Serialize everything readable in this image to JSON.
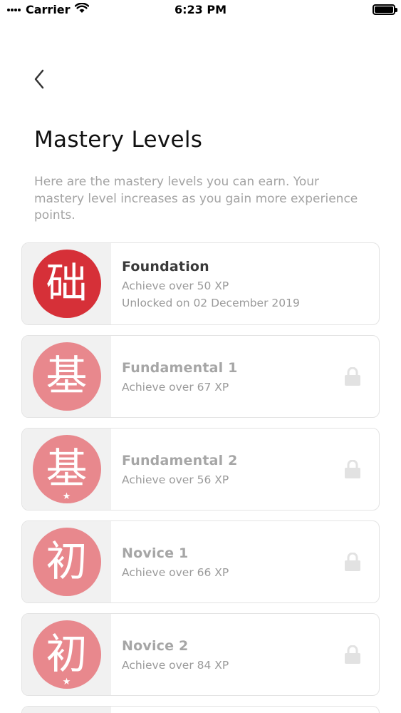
{
  "status_bar": {
    "carrier": "Carrier",
    "time": "6:23 PM",
    "icons": [
      "wifi-icon",
      "battery-icon"
    ]
  },
  "nav": {
    "back_icon": "chevron-left-icon"
  },
  "title": "Mastery Levels",
  "description": "Here are the mastery levels you can earn. Your mastery level increases as you gain more experience points.",
  "colors": {
    "unlocked_badge": "#d63038",
    "locked_badge": "#e8888d",
    "unlocked_title": "#3a3a3a",
    "locked_title": "#a6a6a6",
    "lock_icon": "#e2e2e2"
  },
  "levels": [
    {
      "name": "Foundation",
      "requirement": "Achieve over 50 XP",
      "unlocked": "Unlocked on 02 December 2019",
      "glyph": "础",
      "star": false,
      "locked": false
    },
    {
      "name": "Fundamental 1",
      "requirement": "Achieve over 67 XP",
      "glyph": "基",
      "star": false,
      "locked": true
    },
    {
      "name": "Fundamental 2",
      "requirement": "Achieve over 56 XP",
      "glyph": "基",
      "star": true,
      "locked": true
    },
    {
      "name": "Novice 1",
      "requirement": "Achieve over 66 XP",
      "glyph": "初",
      "star": false,
      "locked": true
    },
    {
      "name": "Novice 2",
      "requirement": "Achieve over 84 XP",
      "glyph": "初",
      "star": true,
      "locked": true
    }
  ]
}
